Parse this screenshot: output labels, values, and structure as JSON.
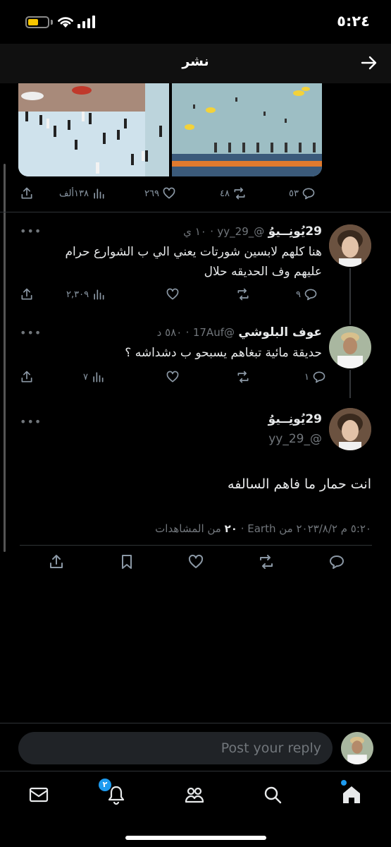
{
  "status_bar": {
    "time": "٥:٢٤"
  },
  "header": {
    "title": "نشر"
  },
  "first_tweet_actions": {
    "views": "١٣٨ألف",
    "likes": "٢٦٩",
    "retweets": "٤٨",
    "replies": "٥٣"
  },
  "replies": [
    {
      "name": "29يُونِــيوُ",
      "handle": "@_29_yy",
      "time": "١٠ ي",
      "text_line1": "هنا كلهم لابسين شورتات يعني الي ب الشوارع حرام",
      "text_line2": "عليهم وف الحديقه حلال",
      "views": "٢,٣٠٩",
      "replies": "٩"
    },
    {
      "name": "عوف البلوشي",
      "handle": "@17Auf",
      "time": "٥٨٠ د",
      "text_line1": "حديقة مائية تبغاهم يسبحو ب دشداشه ؟",
      "views": "٧",
      "replies": "١"
    }
  ],
  "focused_tweet": {
    "name": "29يُونِــيوُ",
    "handle": "@_29_yy",
    "text": "انت حمار ما فاهم السالفه",
    "meta_prefix": "٥:٢٠ م ٢٠٢٣/٨/٢ من Earth",
    "views_count": "٢٠",
    "views_label": "من المشاهدات"
  },
  "reply_bar": {
    "placeholder": "Post your reply"
  },
  "bottom_nav": {
    "notifications_badge": "٢"
  },
  "colors": {
    "accent": "#1d9bf0",
    "background": "#000000",
    "muted": "#71767b"
  }
}
